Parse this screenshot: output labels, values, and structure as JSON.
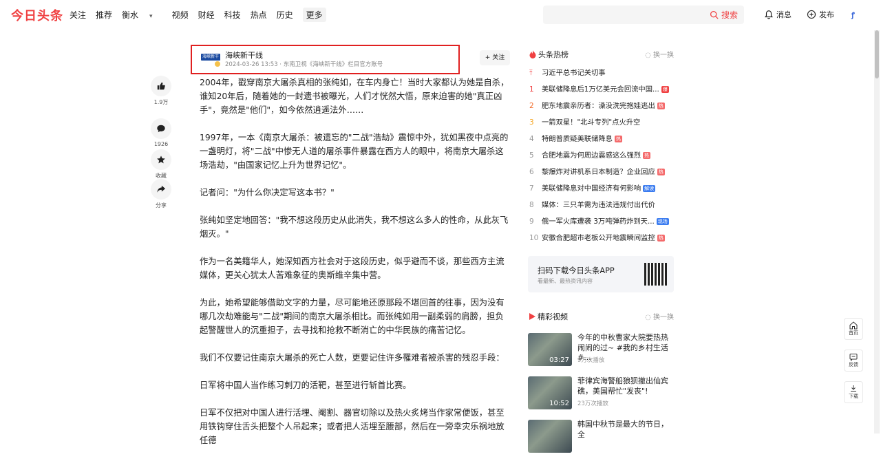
{
  "header": {
    "logo": "今日头条",
    "nav": [
      "关注",
      "推荐",
      "衡水",
      "视频",
      "财经",
      "科技",
      "热点",
      "历史",
      "更多"
    ],
    "search_button": "搜索",
    "messages_label": "消息",
    "publish_label": "发布"
  },
  "author": {
    "logo_text": "海峡新干线",
    "name": "海峡新干线",
    "meta": "2024-03-26 13:53 · 东南卫视《海峡新干线》栏目官方账号",
    "follow_label": "+ 关注"
  },
  "actions": {
    "like_count": "1.9万",
    "comment_count": "1926",
    "favorite_label": "收藏",
    "share_label": "分享"
  },
  "article": {
    "paragraphs": [
      "2004年，戳穿南京大屠杀真相的张纯如，在车内身亡！当时大家都认为她是自杀，谁知20年后，随着她的一封遗书被曝光，人们才恍然大悟，原来迫害的她\"真正凶手\"，竟然是\"他们\"，如今依然逍遥法外……",
      "1997年，一本《南京大屠杀：被遗忘的\"二战\"浩劫》震惊中外，犹如黑夜中点亮的一盏明灯，将\"二战\"中惨无人道的屠杀事件暴露在西方人的眼中，将南京大屠杀这场浩劫，\"由国家记忆上升为世界记忆\"。",
      "记者问：\"为什么你决定写这本书？\"",
      "张纯如坚定地回答：\"我不想这段历史从此消失，我不想这么多人的性命，从此灰飞烟灭。\"",
      "作为一名美籍华人，她深知西方社会对于这段历史，似乎避而不谈，那些西方主流媒体，更关心犹太人苦难象征的奥斯维辛集中营。",
      "为此，她希望能够借助文字的力量，尽可能地还原那段不堪回首的往事，因为没有哪几次劫难能与\"二战\"期间的南京大屠杀相比。而张纯如用一副柔弱的肩膀，担负起警醒世人的沉重担子，去寻找和抢救不断消亡的中华民族的痛苦记忆。",
      "我们不仅要记住南京大屠杀的死亡人数，更要记住许多罹难者被杀害的残忍手段：",
      "日军将中国人当作练习刺刀的活靶，甚至进行斩首比赛。",
      "日军不仅把对中国人进行活埋、阉割、器官切除以及热火炙烤当作家常便饭，甚至用铁钩穿住舌头把整个人吊起来；或者把人活埋至腰部，然后在一旁幸灾乐祸地放任德"
    ]
  },
  "hot": {
    "title": "头条热榜",
    "refresh": "换一换",
    "pinned": "习近平总书记关切事",
    "items": [
      {
        "rank": "1",
        "text": "美联储降息后1万亿美元会回流中国...",
        "tag": "爆",
        "tag_color": "#f04142"
      },
      {
        "rank": "2",
        "text": "肥东地震亲历者：澡没洗完抱娃逃出",
        "tag": "热",
        "tag_color": "#f46a6b"
      },
      {
        "rank": "3",
        "text": "一箭双星！\"北斗专列\"点火升空",
        "tag": "",
        "tag_color": ""
      },
      {
        "rank": "4",
        "text": "特朗普质疑美联储降息",
        "tag": "热",
        "tag_color": "#f46a6b"
      },
      {
        "rank": "5",
        "text": "合肥地震为何周边震感这么强烈",
        "tag": "热",
        "tag_color": "#f46a6b"
      },
      {
        "rank": "6",
        "text": "黎爆炸对讲机系日本制造？企业回应",
        "tag": "热",
        "tag_color": "#f46a6b"
      },
      {
        "rank": "7",
        "text": "美联储降息对中国经济有何影响",
        "tag": "解读",
        "tag_color": "#3b7cf0"
      },
      {
        "rank": "8",
        "text": "媒体：三只羊需为违法违规付出代价",
        "tag": "",
        "tag_color": ""
      },
      {
        "rank": "9",
        "text": "俄一军火库遭袭 3万吨弹药炸到天...",
        "tag": "现场",
        "tag_color": "#3b7cf0"
      },
      {
        "rank": "10",
        "text": "安徽合肥超市老板公开地震瞬间监控",
        "tag": "热",
        "tag_color": "#f46a6b"
      }
    ]
  },
  "app_promo": {
    "title": "扫码下载今日头条APP",
    "subtitle": "看最新、最热资讯内容"
  },
  "videos": {
    "title": "精彩视频",
    "refresh": "换一换",
    "items": [
      {
        "title": "今年的中秋曹家大院要热热闹闹的过~ #我的乡村生活 #...",
        "duration": "03:27",
        "plays": "9万次播放"
      },
      {
        "title": "菲律宾海警船狼狈撤出仙宾礁，美国帮忙\"发丧\"!",
        "duration": "10:52",
        "plays": "23万次播放"
      },
      {
        "title": "韩国中秋节是最大的节日，全",
        "duration": "",
        "plays": ""
      }
    ]
  },
  "float_tools": {
    "home": "首页",
    "feedback": "反馈",
    "download": "下载"
  },
  "colors": {
    "brand": "#f04142",
    "highlight_border": "#e02020"
  }
}
